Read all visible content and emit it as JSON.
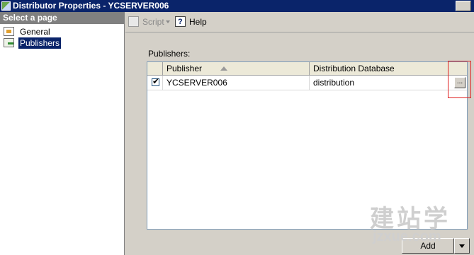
{
  "window": {
    "title": "Distributor Properties - YCSERVER006"
  },
  "sidebar": {
    "header": "Select a page",
    "items": [
      {
        "label": "General",
        "icon": "properties-icon"
      },
      {
        "label": "Publishers",
        "icon": "publishers-icon",
        "selected": true
      }
    ]
  },
  "toolbar": {
    "script_label": "Script",
    "help_label": "Help"
  },
  "publishers": {
    "label": "Publishers:",
    "columns": [
      "Publisher",
      "Distribution Database"
    ],
    "rows": [
      {
        "checked": true,
        "publisher": "YCSERVER006",
        "distribution_database": "distribution"
      }
    ],
    "ellipsis_label": "..."
  },
  "footer": {
    "add_label": "Add"
  },
  "watermark": {
    "glyphs": "建站学",
    "url": "jzxue.com"
  },
  "colors": {
    "title_bar": "#0a246a",
    "selection": "#0a246a",
    "highlight_box": "#e02020"
  }
}
